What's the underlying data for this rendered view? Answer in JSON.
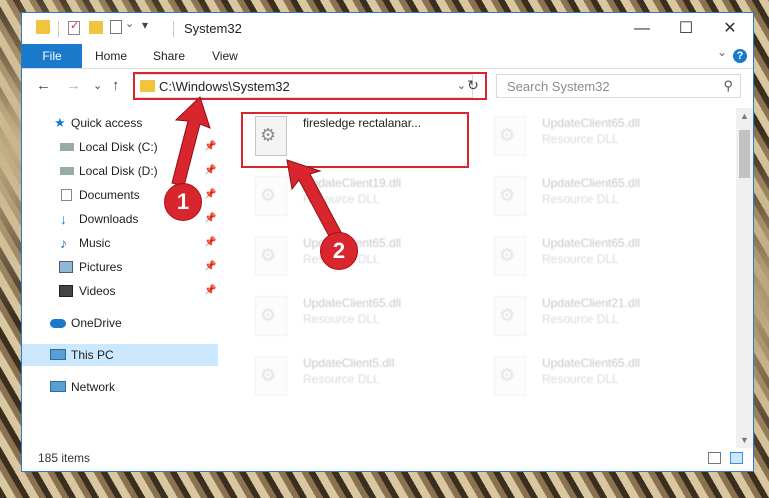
{
  "window": {
    "title": "System32",
    "controls": {
      "minimize": "—",
      "maximize": "☐",
      "close": "✕"
    }
  },
  "ribbon": {
    "tabs": [
      "File",
      "Home",
      "Share",
      "View"
    ],
    "expand_chevron": "⌄",
    "help": "?"
  },
  "nav": {
    "back": "←",
    "forward": "→",
    "recent": "⌄",
    "up": "↑",
    "address": "C:\\Windows\\System32",
    "address_chevron": "⌄",
    "refresh": "↻",
    "search_placeholder": "Search System32",
    "search_icon": "⚲"
  },
  "sidebar": {
    "items": [
      {
        "label": "Quick access",
        "icon": "star-icon",
        "pinned": false
      },
      {
        "label": "Local Disk (C:)",
        "icon": "drive-icon",
        "pinned": true
      },
      {
        "label": "Local Disk (D:)",
        "icon": "drive-icon",
        "pinned": true
      },
      {
        "label": "Documents",
        "icon": "documents-icon",
        "pinned": true
      },
      {
        "label": "Downloads",
        "icon": "download-icon",
        "pinned": true
      },
      {
        "label": "Music",
        "icon": "music-icon",
        "pinned": true
      },
      {
        "label": "Pictures",
        "icon": "pictures-icon",
        "pinned": true
      },
      {
        "label": "Videos",
        "icon": "videos-icon",
        "pinned": true
      },
      {
        "label": "OneDrive",
        "icon": "cloud-icon",
        "pinned": false
      },
      {
        "label": "This PC",
        "icon": "computer-icon",
        "pinned": false,
        "selected": true
      },
      {
        "label": "Network",
        "icon": "network-icon",
        "pinned": false
      }
    ],
    "pin_glyph": "📌"
  },
  "files": {
    "left": [
      {
        "name": "firesledge rectalanar...",
        "type": "",
        "highlighted": true
      },
      {
        "name": "UpdateClient19.dll",
        "type": "Resource DLL"
      },
      {
        "name": "UpdateClient65.dll",
        "type": "Resource DLL"
      },
      {
        "name": "UpdateClient65.dll",
        "type": "Resource DLL"
      },
      {
        "name": "UpdateClient5.dll",
        "type": "Resource DLL"
      }
    ],
    "right": [
      {
        "name": "UpdateClient65.dll",
        "type": "Resource DLL"
      },
      {
        "name": "UpdateClient65.dll",
        "type": "Resource DLL"
      },
      {
        "name": "UpdateClient65.dll",
        "type": "Resource DLL"
      },
      {
        "name": "UpdateClient21.dll",
        "type": "Resource DLL"
      },
      {
        "name": "UpdateClient65.dll",
        "type": "Resource DLL"
      }
    ]
  },
  "status": {
    "count": "185 items"
  },
  "callouts": {
    "one": "1",
    "two": "2"
  },
  "colors": {
    "accent": "#1979ca",
    "highlight": "#d9262e",
    "selected": "#cce8ff"
  }
}
